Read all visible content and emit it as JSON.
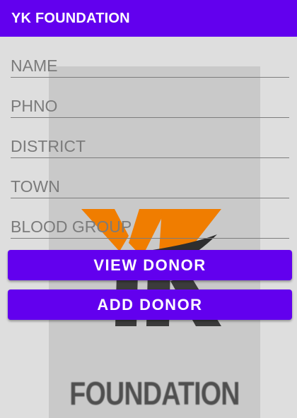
{
  "app_bar": {
    "title": "YK FOUNDATION",
    "color": "#6200ee"
  },
  "form": {
    "fields": [
      {
        "placeholder": "NAME",
        "value": ""
      },
      {
        "placeholder": "PHNO",
        "value": ""
      },
      {
        "placeholder": "DISTRICT",
        "value": ""
      },
      {
        "placeholder": "TOWN",
        "value": ""
      },
      {
        "placeholder": "BLOOD GROUP",
        "value": ""
      }
    ]
  },
  "buttons": {
    "view_donor": "VIEW DONOR",
    "add_donor": "ADD DONOR"
  },
  "logo": {
    "text": "FOUNDATION",
    "accent_color": "#f07d00",
    "dark_color": "#3c3c3c"
  }
}
